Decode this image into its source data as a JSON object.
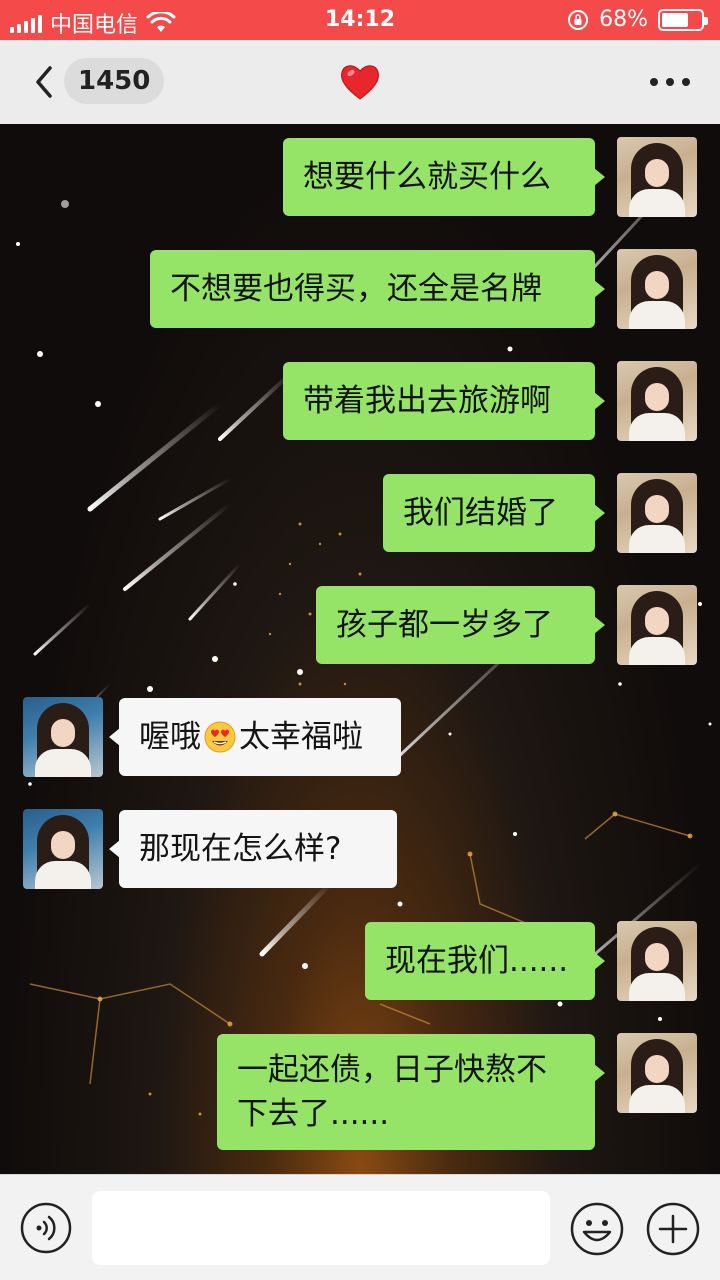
{
  "status_bar": {
    "carrier": "中国电信",
    "time": "14:12",
    "battery": "68%",
    "battery_level": 0.68,
    "icons": [
      "signal-icon",
      "wifi-icon",
      "rotation-lock-icon",
      "battery-icon"
    ]
  },
  "header": {
    "back_icon": "chevron-left-icon",
    "unread_count": "1450",
    "title_icon": "red-heart-icon",
    "more_icon": "more-dots-icon"
  },
  "messages": [
    {
      "side": "out",
      "text": "想要什么就买什么"
    },
    {
      "side": "out",
      "text": "不想要也得买，还全是名牌"
    },
    {
      "side": "out",
      "text": "带着我出去旅游啊"
    },
    {
      "side": "out",
      "text": "我们结婚了"
    },
    {
      "side": "out",
      "text": "孩子都一岁多了"
    },
    {
      "side": "in",
      "text_before": "喔哦",
      "emoji": "heart-eyes-emoji",
      "text_after": "太幸福啦"
    },
    {
      "side": "in",
      "text": "那现在怎么样?"
    },
    {
      "side": "out",
      "text": "现在我们......"
    },
    {
      "side": "out",
      "text_line1": "一起还债，日子快熬不",
      "text_line2": "下去了......"
    }
  ],
  "input_bar": {
    "placeholder": "",
    "icons": [
      "voice-icon",
      "emoji-icon",
      "plus-icon"
    ]
  },
  "colors": {
    "status_bar": "#f44a4a",
    "title_bar": "#ececec",
    "outgoing_bubble": "#95e467",
    "incoming_bubble": "#f6f6f6"
  }
}
